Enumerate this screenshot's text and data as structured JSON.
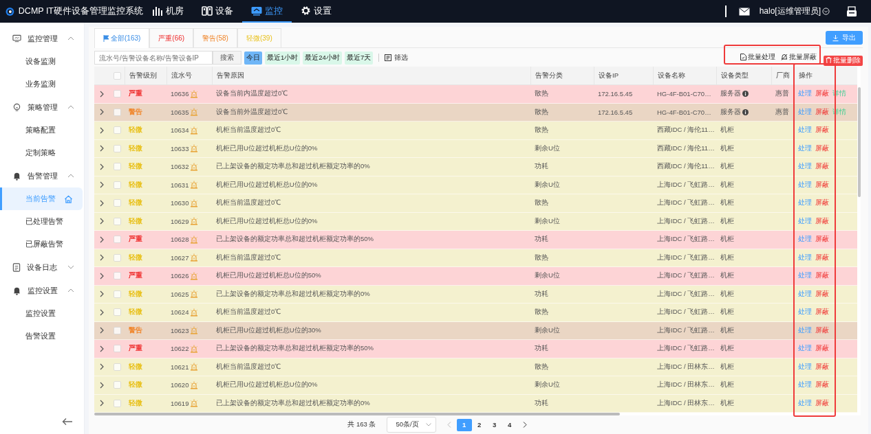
{
  "header": {
    "title": "DCMP IT硬件设备管理监控系统",
    "nav": [
      {
        "label": "机房",
        "selected": false
      },
      {
        "label": "设备",
        "selected": false
      },
      {
        "label": "监控",
        "selected": true
      },
      {
        "label": "设置",
        "selected": false
      }
    ],
    "user": "halo[运维管理员]"
  },
  "sidebar": {
    "groups": [
      {
        "label": "监控管理",
        "expanded": true,
        "children": [
          {
            "label": "设备监测",
            "selected": false
          },
          {
            "label": "业务监测",
            "selected": false
          }
        ]
      },
      {
        "label": "策略管理",
        "expanded": true,
        "children": [
          {
            "label": "策略配置",
            "selected": false
          },
          {
            "label": "定制策略",
            "selected": false
          }
        ]
      },
      {
        "label": "告警管理",
        "expanded": true,
        "children": [
          {
            "label": "当前告警",
            "selected": true
          },
          {
            "label": "已处理告警",
            "selected": false
          },
          {
            "label": "已屏蔽告警",
            "selected": false
          }
        ]
      },
      {
        "label": "设备日志",
        "expanded": false
      },
      {
        "label": "监控设置",
        "expanded": true,
        "children": [
          {
            "label": "监控设置",
            "selected": false
          },
          {
            "label": "告警设置",
            "selected": false
          }
        ]
      }
    ]
  },
  "export_button": "导出",
  "tabs": [
    {
      "label": "全部(163)",
      "kind": "all",
      "selected": true
    },
    {
      "label": "严重(66)",
      "kind": "severe",
      "selected": false
    },
    {
      "label": "警告(58)",
      "kind": "warning",
      "selected": false
    },
    {
      "label": "轻微(39)",
      "kind": "minor",
      "selected": false
    }
  ],
  "search": {
    "placeholder": "流水号/告警设备名称/告警设备IP",
    "button": "搜索"
  },
  "time_filters": [
    {
      "label": "今日",
      "selected": true
    },
    {
      "label": "最近1小时",
      "selected": false
    },
    {
      "label": "最近24小时",
      "selected": false
    },
    {
      "label": "最近7天",
      "selected": false
    }
  ],
  "filter_button": "筛选",
  "batch_actions": {
    "highlighted": true,
    "items": [
      {
        "label": "批量处理",
        "kind": "handle"
      },
      {
        "label": "批量屏蔽",
        "kind": "shield"
      }
    ]
  },
  "batch_delete": "批量删除",
  "table": {
    "columns": [
      "告警级别",
      "流水号",
      "告警原因",
      "告警分类",
      "设备IP",
      "设备名称",
      "设备类型",
      "厂商",
      "操作"
    ],
    "all_checked": false,
    "ops_highlighted": true,
    "rows": [
      {
        "checked": false,
        "severity": "严重",
        "kind": "severe",
        "serial": "10636",
        "reason": "设备当前内温度超过0℃",
        "category": "散热",
        "ip": "172.16.5.45",
        "device": "HG-4F-B01-C70…",
        "type": "服务器",
        "type_info": true,
        "vendor": "惠普",
        "actions": [
          {
            "label": "处理",
            "kind": "handle"
          },
          {
            "label": "屏蔽",
            "kind": "shield"
          },
          {
            "label": "详情",
            "kind": "detail"
          }
        ]
      },
      {
        "checked": false,
        "severity": "警告",
        "kind": "warning",
        "serial": "10635",
        "reason": "设备当前外温度超过0℃",
        "category": "散热",
        "ip": "172.16.5.45",
        "device": "HG-4F-B01-C70…",
        "type": "服务器",
        "type_info": true,
        "vendor": "惠普",
        "actions": [
          {
            "label": "处理",
            "kind": "handle"
          },
          {
            "label": "屏蔽",
            "kind": "shield"
          },
          {
            "label": "详情",
            "kind": "detail"
          }
        ]
      },
      {
        "checked": false,
        "severity": "轻微",
        "kind": "minor",
        "serial": "10634",
        "reason": "机柜当前温度超过0℃",
        "category": "散热",
        "device": "西藏IDC / 海伦11…",
        "type": "机柜",
        "type_info": false,
        "actions": [
          {
            "label": "处理",
            "kind": "handle"
          },
          {
            "label": "屏蔽",
            "kind": "shield"
          }
        ]
      },
      {
        "checked": false,
        "severity": "轻微",
        "kind": "minor",
        "serial": "10633",
        "reason": "机柜已用U位超过机柜总U位的0%",
        "category": "剩余U位",
        "device": "西藏IDC / 海伦11…",
        "type": "机柜",
        "type_info": false,
        "actions": [
          {
            "label": "处理",
            "kind": "handle"
          },
          {
            "label": "屏蔽",
            "kind": "shield"
          }
        ]
      },
      {
        "checked": false,
        "severity": "轻微",
        "kind": "minor",
        "serial": "10632",
        "reason": "已上架设备的额定功率总和超过机柜额定功率的0%",
        "category": "功耗",
        "device": "西藏IDC / 海伦11…",
        "type": "机柜",
        "type_info": false,
        "actions": [
          {
            "label": "处理",
            "kind": "handle"
          },
          {
            "label": "屏蔽",
            "kind": "shield"
          }
        ]
      },
      {
        "checked": false,
        "severity": "轻微",
        "kind": "minor",
        "serial": "10631",
        "reason": "机柜已用U位超过机柜总U位的0%",
        "category": "剩余U位",
        "device": "上海IDC / 飞虹路…",
        "type": "机柜",
        "type_info": false,
        "actions": [
          {
            "label": "处理",
            "kind": "handle"
          },
          {
            "label": "屏蔽",
            "kind": "shield"
          }
        ]
      },
      {
        "checked": false,
        "severity": "轻微",
        "kind": "minor",
        "serial": "10630",
        "reason": "机柜当前温度超过0℃",
        "category": "散热",
        "device": "上海IDC / 飞虹路…",
        "type": "机柜",
        "type_info": false,
        "actions": [
          {
            "label": "处理",
            "kind": "handle"
          },
          {
            "label": "屏蔽",
            "kind": "shield"
          }
        ]
      },
      {
        "checked": false,
        "severity": "轻微",
        "kind": "minor",
        "serial": "10629",
        "reason": "机柜已用U位超过机柜总U位的0%",
        "category": "剩余U位",
        "device": "上海IDC / 飞虹路…",
        "type": "机柜",
        "type_info": false,
        "actions": [
          {
            "label": "处理",
            "kind": "handle"
          },
          {
            "label": "屏蔽",
            "kind": "shield"
          }
        ]
      },
      {
        "checked": false,
        "severity": "严重",
        "kind": "severe",
        "serial": "10628",
        "reason": "已上架设备的额定功率总和超过机柜额定功率的50%",
        "category": "功耗",
        "device": "上海IDC / 飞虹路…",
        "type": "机柜",
        "type_info": false,
        "actions": [
          {
            "label": "处理",
            "kind": "handle"
          },
          {
            "label": "屏蔽",
            "kind": "shield"
          }
        ]
      },
      {
        "checked": false,
        "severity": "轻微",
        "kind": "minor",
        "serial": "10627",
        "reason": "机柜当前温度超过0℃",
        "category": "散热",
        "device": "上海IDC / 飞虹路…",
        "type": "机柜",
        "type_info": false,
        "actions": [
          {
            "label": "处理",
            "kind": "handle"
          },
          {
            "label": "屏蔽",
            "kind": "shield"
          }
        ]
      },
      {
        "checked": false,
        "severity": "严重",
        "kind": "severe",
        "serial": "10626",
        "reason": "机柜已用U位超过机柜总U位的50%",
        "category": "剩余U位",
        "device": "上海IDC / 飞虹路…",
        "type": "机柜",
        "type_info": false,
        "actions": [
          {
            "label": "处理",
            "kind": "handle"
          },
          {
            "label": "屏蔽",
            "kind": "shield"
          }
        ]
      },
      {
        "checked": false,
        "severity": "轻微",
        "kind": "minor",
        "serial": "10625",
        "reason": "已上架设备的额定功率总和超过机柜额定功率的0%",
        "category": "功耗",
        "device": "上海IDC / 飞虹路…",
        "type": "机柜",
        "type_info": false,
        "actions": [
          {
            "label": "处理",
            "kind": "handle"
          },
          {
            "label": "屏蔽",
            "kind": "shield"
          }
        ]
      },
      {
        "checked": false,
        "severity": "轻微",
        "kind": "minor",
        "serial": "10624",
        "reason": "机柜当前温度超过0℃",
        "category": "散热",
        "device": "上海IDC / 飞虹路…",
        "type": "机柜",
        "type_info": false,
        "actions": [
          {
            "label": "处理",
            "kind": "handle"
          },
          {
            "label": "屏蔽",
            "kind": "shield"
          }
        ]
      },
      {
        "checked": false,
        "severity": "警告",
        "kind": "warning",
        "serial": "10623",
        "reason": "机柜已用U位超过机柜总U位的30%",
        "category": "剩余U位",
        "device": "上海IDC / 飞虹路…",
        "type": "机柜",
        "type_info": false,
        "actions": [
          {
            "label": "处理",
            "kind": "handle"
          },
          {
            "label": "屏蔽",
            "kind": "shield"
          }
        ]
      },
      {
        "checked": false,
        "severity": "严重",
        "kind": "severe",
        "serial": "10622",
        "reason": "已上架设备的额定功率总和超过机柜额定功率的50%",
        "category": "功耗",
        "device": "上海IDC / 飞虹路…",
        "type": "机柜",
        "type_info": false,
        "actions": [
          {
            "label": "处理",
            "kind": "handle"
          },
          {
            "label": "屏蔽",
            "kind": "shield"
          }
        ]
      },
      {
        "checked": false,
        "severity": "轻微",
        "kind": "minor",
        "serial": "10621",
        "reason": "机柜当前温度超过0℃",
        "category": "散热",
        "device": "上海IDC / 田林东…",
        "type": "机柜",
        "type_info": false,
        "actions": [
          {
            "label": "处理",
            "kind": "handle"
          },
          {
            "label": "屏蔽",
            "kind": "shield"
          }
        ]
      },
      {
        "checked": false,
        "severity": "轻微",
        "kind": "minor",
        "serial": "10620",
        "reason": "机柜已用U位超过机柜总U位的0%",
        "category": "剩余U位",
        "device": "上海IDC / 田林东…",
        "type": "机柜",
        "type_info": false,
        "actions": [
          {
            "label": "处理",
            "kind": "handle"
          },
          {
            "label": "屏蔽",
            "kind": "shield"
          }
        ]
      },
      {
        "checked": false,
        "severity": "轻微",
        "kind": "minor",
        "serial": "10619",
        "reason": "已上架设备的额定功率总和超过机柜额定功率的0%",
        "category": "功耗",
        "device": "上海IDC / 田林东…",
        "type": "机柜",
        "type_info": false,
        "actions": [
          {
            "label": "处理",
            "kind": "handle"
          },
          {
            "label": "屏蔽",
            "kind": "shield"
          }
        ]
      }
    ]
  },
  "pagination": {
    "total": "共 163 条",
    "page_size": "50条/页",
    "pages": [
      {
        "label": "1",
        "selected": true
      },
      {
        "label": "2",
        "selected": false
      },
      {
        "label": "3",
        "selected": false
      },
      {
        "label": "4",
        "selected": false
      }
    ]
  }
}
